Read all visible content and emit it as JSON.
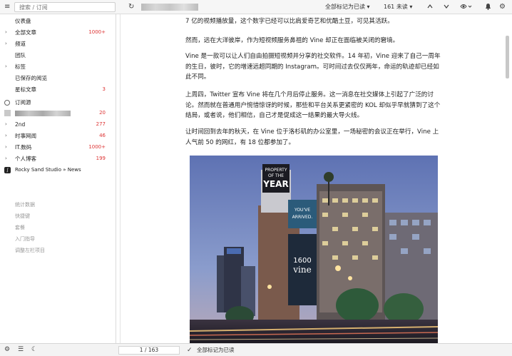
{
  "toolbar": {
    "search_placeholder": "搜索 / 订阅",
    "mark_all_read": "全部标记为已读",
    "unread_count": "161 未读",
    "icons": [
      "hamburger-icon",
      "refresh-icon",
      "chevron-up-icon",
      "chevron-down-icon",
      "eye-icon",
      "bell-icon",
      "settings-icon"
    ]
  },
  "sidebar": {
    "items": [
      {
        "label": "仪表盘",
        "count": ""
      },
      {
        "label": "全部文章",
        "count": "1000+"
      },
      {
        "label": "频道",
        "count": ""
      },
      {
        "label": "团队",
        "count": ""
      },
      {
        "label": "标签",
        "count": ""
      },
      {
        "label": "已保存的阅览",
        "count": ""
      },
      {
        "label": "星标文章",
        "count": "3"
      }
    ],
    "subscriptions_header": "订阅源",
    "feeds": [
      {
        "label": "",
        "count": "20"
      },
      {
        "label": "2nd",
        "count": "277"
      },
      {
        "label": "时事网闻",
        "count": "46"
      },
      {
        "label": "IT.数码",
        "count": "1000+"
      },
      {
        "label": "个人博客",
        "count": "199"
      },
      {
        "label": "Rocky Sand Studio » News",
        "count": ""
      }
    ],
    "footer_links": [
      "统计数据",
      "快捷键",
      "套餐",
      "入门指导",
      "调整左栏项目"
    ]
  },
  "article": {
    "paragraphs": [
      "7 亿的视频播放量，这个数字已经可以比肩爱奇艺和优酷土豆，可见其活跃。",
      "然而，远在大洋彼岸，作为短视频服务鼻祖的 Vine 却正在面临被关闭的窘境。",
      "Vine 是一款可以让人们自由拍摄短视频并分享的社交软件。14 年初，Vine 迎来了自己一周年的生日，彼时，它的增速远超同期的 Instagram。可时间过去仅仅两年，命运的轨迹却已经如此不同。",
      "上周四，Twitter 宣布 Vine 将在几个月后停止服务。这一消息在社交媒体上引起了广泛的讨论。然而就在普通用户惋惜惊讶的时候，那些和平台关系更紧密的 KOL 却似乎早就猜到了这个结局，或者说，他们相信，自己才是促成这一结果的最大导火线。",
      "让时间回到去年的秋天，在 Vine 位于洛杉矶的办公室里，一场秘密的会议正在举行，Vine 上人气前 50 的网红，有 18 位都参加了。"
    ],
    "image": {
      "sign_lines": [
        "PROPERTY",
        "OF THE",
        "YEAR"
      ],
      "banner_lines": [
        "YOU'VE",
        "ARRIVED."
      ],
      "building_lines": [
        "1600",
        "vine"
      ]
    }
  },
  "bottombar": {
    "page_indicator": "1 / 163",
    "mark_all_read": "全部标记为已读",
    "icons": [
      "settings-gear-icon",
      "list-view-icon",
      "moon-icon",
      "check-icon"
    ]
  },
  "colors": {
    "count_red": "#dd3333",
    "sidebar_bg": "#ffffff",
    "toolbar_bg": "#f6f6f6"
  }
}
